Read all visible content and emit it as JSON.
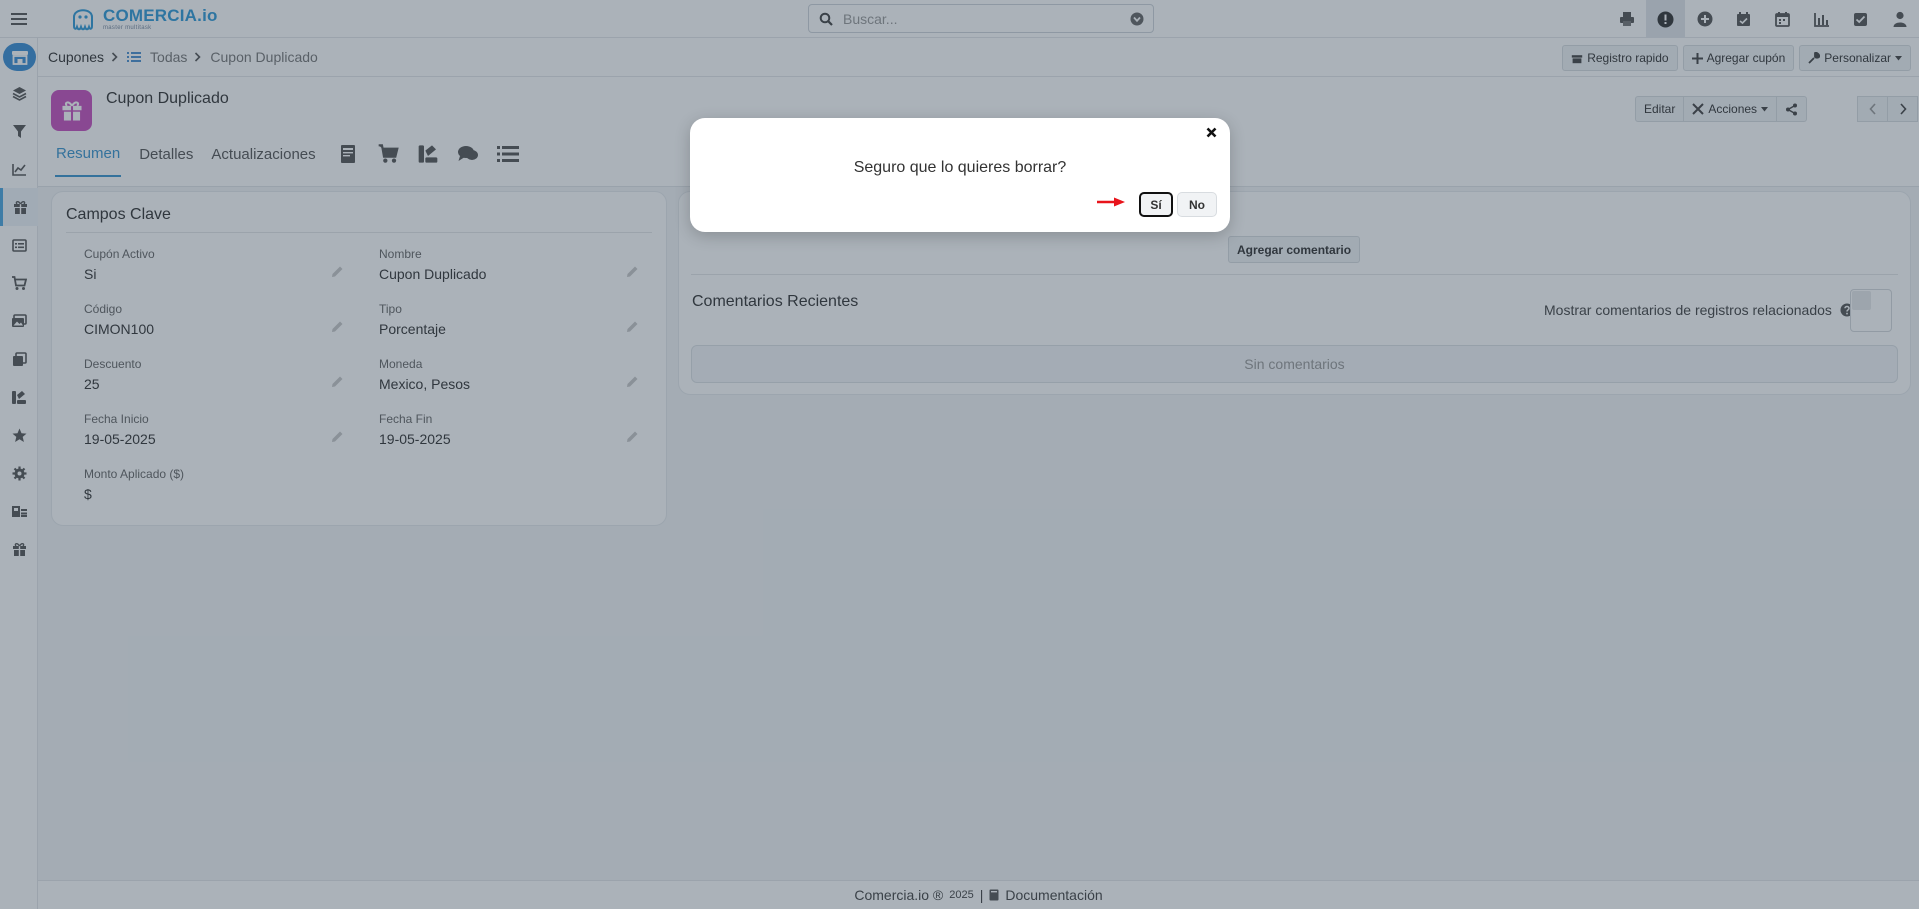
{
  "app": {
    "name": "COMERCIA.io",
    "tagline": "master multitask"
  },
  "search": {
    "placeholder": "Buscar..."
  },
  "top_icons": [
    "printer-icon",
    "alert-icon",
    "plus-circle-icon",
    "calendar-check-icon",
    "calendar-icon",
    "bar-chart-icon",
    "check-square-icon",
    "user-icon"
  ],
  "sidebar_icons": [
    "store-icon",
    "layers-icon",
    "filter-icon",
    "line-chart-icon",
    "gift-icon",
    "list-icon",
    "cart-icon",
    "images-icon",
    "copy-icon",
    "brush-icon",
    "star-icon",
    "settings-icon",
    "store-list-icon",
    "gift-small-icon"
  ],
  "breadcrumb": {
    "root": "Cupones",
    "list": "Todas",
    "current": "Cupon Duplicado"
  },
  "header_actions": {
    "quick": "Registro rapido",
    "add": "Agregar cupón",
    "customize": "Personalizar"
  },
  "record": {
    "title": "Cupon Duplicado",
    "edit": "Editar",
    "actions": "Acciones",
    "tabs": [
      "Resumen",
      "Detalles",
      "Actualizaciones"
    ],
    "tab_icons": [
      "receipt-icon",
      "cart-icon",
      "brush-icon",
      "comments-icon",
      "list-icon"
    ]
  },
  "key_fields": {
    "title": "Campos Clave",
    "fields": [
      {
        "label": "Cupón Activo",
        "value": "Si"
      },
      {
        "label": "Nombre",
        "value": "Cupon Duplicado"
      },
      {
        "label": "Código",
        "value": "CIMON100"
      },
      {
        "label": "Tipo",
        "value": "Porcentaje"
      },
      {
        "label": "Descuento",
        "value": "25"
      },
      {
        "label": "Moneda",
        "value": "Mexico, Pesos"
      },
      {
        "label": "Fecha Inicio",
        "value": "19-05-2025"
      },
      {
        "label": "Fecha Fin",
        "value": "19-05-2025"
      },
      {
        "label": "Monto Aplicado ($)",
        "value": "$"
      }
    ]
  },
  "comments": {
    "add_button": "Agregar comentario",
    "title": "Comentarios Recientes",
    "related_label": "Mostrar comentarios de registros relacionados",
    "empty": "Sin comentarios"
  },
  "footer": {
    "brand": "Comercia.io ®",
    "year": "2025",
    "divider": "|",
    "docs": "Documentación"
  },
  "modal": {
    "message": "Seguro que lo quieres borrar?",
    "yes": "Sí",
    "no": "No"
  },
  "colors": {
    "accent": "#3a94cf",
    "record_avatar": "#c64fbf",
    "annotation_arrow": "#e8141b"
  }
}
